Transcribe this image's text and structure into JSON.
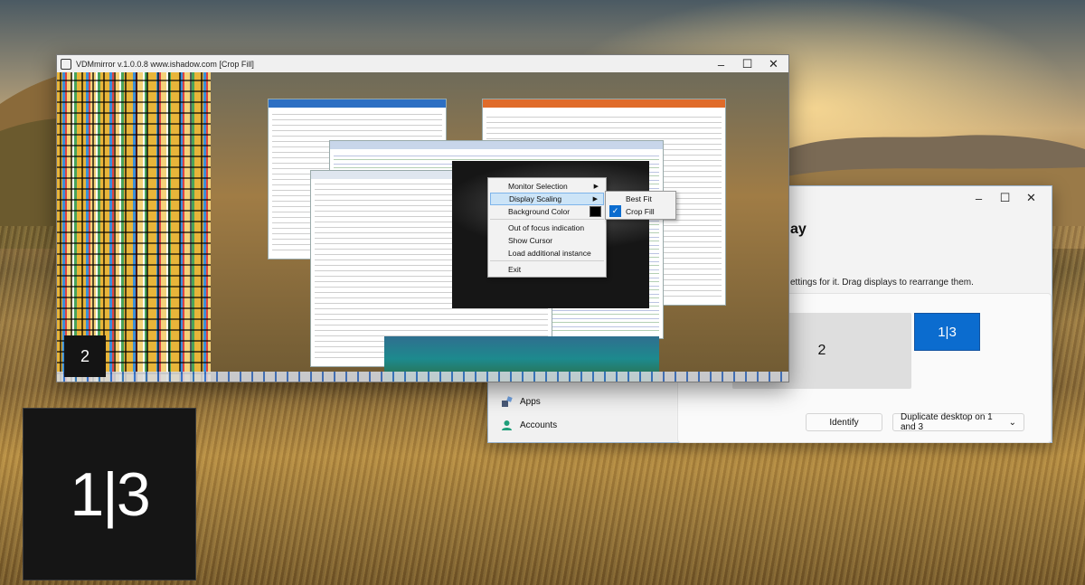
{
  "vdm_window": {
    "title": "VDMmirror v.1.0.0.8 www.ishadow.com [Crop Fill]",
    "identifier_badge": "2"
  },
  "context_menu": {
    "items": [
      {
        "label": "Monitor Selection"
      },
      {
        "label": "Display Scaling"
      },
      {
        "label": "Background Color"
      },
      {
        "label": "Out of focus indication"
      },
      {
        "label": "Show Cursor"
      },
      {
        "label": "Load additional instance"
      },
      {
        "label": "Exit"
      }
    ],
    "background_swatch_color": "#000000",
    "highlight_color": "#cce4f7"
  },
  "scaling_submenu": {
    "items": [
      {
        "label": "Best Fit",
        "checked": false
      },
      {
        "label": "Crop Fill",
        "checked": true
      }
    ]
  },
  "settings_window": {
    "heading": "ay",
    "description": "ettings for it. Drag displays to rearrange them.",
    "monitors": [
      {
        "label": "2",
        "selected": false
      },
      {
        "label": "1|3",
        "selected": true
      }
    ],
    "identify_button": "Identify",
    "duplicate_dropdown": "Duplicate desktop on 1 and 3",
    "nav": [
      {
        "label": "Apps"
      },
      {
        "label": "Accounts"
      }
    ],
    "accent_color": "#0b6ccf"
  },
  "identifier_overlay": {
    "label": "1|3"
  },
  "window_controls": {
    "minimize": "–",
    "maximize": "☐",
    "close": "✕"
  }
}
